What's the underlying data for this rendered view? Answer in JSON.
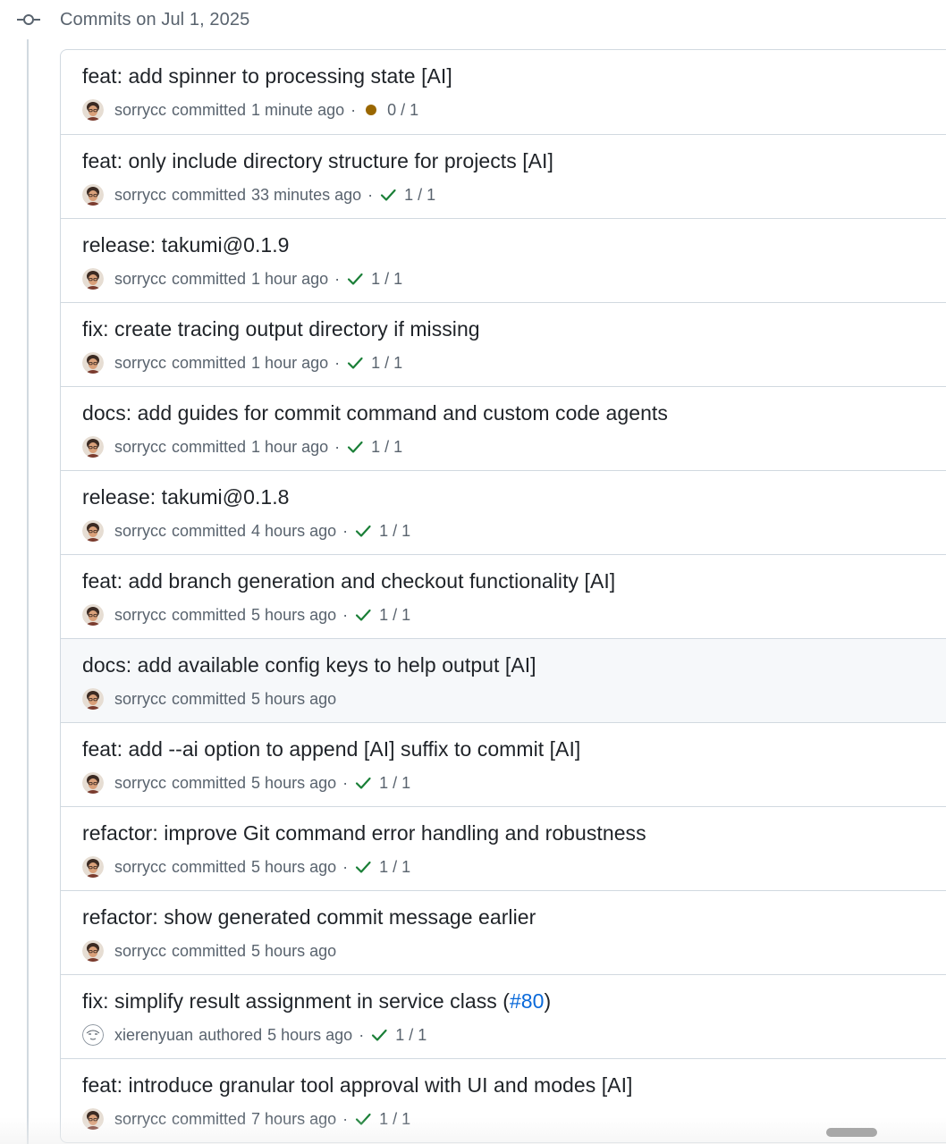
{
  "group": {
    "title": "Commits on Jul 1, 2025",
    "icon": "git-commit-icon"
  },
  "colors": {
    "success": "#1a7f37",
    "pending": "#9a6700",
    "link": "#0969da",
    "muted": "#59636e"
  },
  "commits": [
    {
      "title": "feat: add spinner to processing state [AI]",
      "author": "sorrycc",
      "verb": "committed",
      "time": "1 minute ago",
      "status": "pending",
      "checks": "0 / 1"
    },
    {
      "title": "feat: only include directory structure for projects [AI]",
      "author": "sorrycc",
      "verb": "committed",
      "time": "33 minutes ago",
      "status": "success",
      "checks": "1 / 1"
    },
    {
      "title": "release: takumi@0.1.9",
      "author": "sorrycc",
      "verb": "committed",
      "time": "1 hour ago",
      "status": "success",
      "checks": "1 / 1"
    },
    {
      "title": "fix: create tracing output directory if missing",
      "author": "sorrycc",
      "verb": "committed",
      "time": "1 hour ago",
      "status": "success",
      "checks": "1 / 1"
    },
    {
      "title": "docs: add guides for commit command and custom code agents",
      "author": "sorrycc",
      "verb": "committed",
      "time": "1 hour ago",
      "status": "success",
      "checks": "1 / 1"
    },
    {
      "title": "release: takumi@0.1.8",
      "author": "sorrycc",
      "verb": "committed",
      "time": "4 hours ago",
      "status": "success",
      "checks": "1 / 1"
    },
    {
      "title": "feat: add branch generation and checkout functionality [AI]",
      "author": "sorrycc",
      "verb": "committed",
      "time": "5 hours ago",
      "status": "success",
      "checks": "1 / 1"
    },
    {
      "title": "docs: add available config keys to help output [AI]",
      "author": "sorrycc",
      "verb": "committed",
      "time": "5 hours ago",
      "status": "none",
      "checks": "",
      "hover": true
    },
    {
      "title": "feat: add --ai option to append [AI] suffix to commit [AI]",
      "author": "sorrycc",
      "verb": "committed",
      "time": "5 hours ago",
      "status": "success",
      "checks": "1 / 1"
    },
    {
      "title": "refactor: improve Git command error handling and robustness",
      "author": "sorrycc",
      "verb": "committed",
      "time": "5 hours ago",
      "status": "success",
      "checks": "1 / 1"
    },
    {
      "title": "refactor: show generated commit message earlier",
      "author": "sorrycc",
      "verb": "committed",
      "time": "5 hours ago",
      "status": "none",
      "checks": ""
    },
    {
      "title": "fix: simplify result assignment in service class (",
      "pr": "#80",
      "title_suffix": ")",
      "author": "xierenyuan",
      "verb": "authored",
      "time": "5 hours ago",
      "status": "success",
      "checks": "1 / 1",
      "avatar": "sketch"
    },
    {
      "title": "feat: introduce granular tool approval with UI and modes [AI]",
      "author": "sorrycc",
      "verb": "committed",
      "time": "7 hours ago",
      "status": "success",
      "checks": "1 / 1"
    }
  ]
}
